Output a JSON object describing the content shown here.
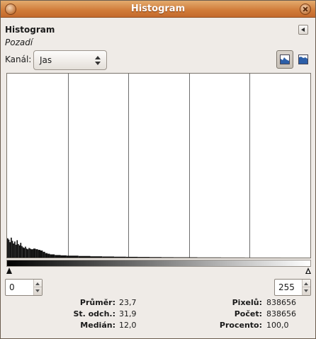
{
  "window": {
    "title": "Histogram"
  },
  "dialog": {
    "title": "Histogram",
    "subtitle": "Pozadí"
  },
  "channel": {
    "label": "Kanál:",
    "value": "Jas"
  },
  "range": {
    "min": "0",
    "max": "255"
  },
  "stats_left": [
    {
      "label": "Průměr:",
      "value": "23,7"
    },
    {
      "label": "St. odch.:",
      "value": "31,9"
    },
    {
      "label": "Medián:",
      "value": "12,0"
    }
  ],
  "stats_right": [
    {
      "label": "Pixelů:",
      "value": "838656"
    },
    {
      "label": "Počet:",
      "value": "838656"
    },
    {
      "label": "Procento:",
      "value": "100,0"
    }
  ],
  "chart_data": {
    "type": "area",
    "x_range": [
      0,
      255
    ],
    "grid": "vertical lines at quarter intervals",
    "color": "#111111",
    "bins": [
      {
        "x": 0,
        "y": 30
      },
      {
        "x": 1,
        "y": 28
      },
      {
        "x": 2,
        "y": 24
      },
      {
        "x": 3,
        "y": 31
      },
      {
        "x": 4,
        "y": 26
      },
      {
        "x": 5,
        "y": 22
      },
      {
        "x": 6,
        "y": 25
      },
      {
        "x": 7,
        "y": 20
      },
      {
        "x": 8,
        "y": 27
      },
      {
        "x": 9,
        "y": 21
      },
      {
        "x": 10,
        "y": 19
      },
      {
        "x": 11,
        "y": 23
      },
      {
        "x": 12,
        "y": 18
      },
      {
        "x": 13,
        "y": 16
      },
      {
        "x": 14,
        "y": 15
      },
      {
        "x": 15,
        "y": 17
      },
      {
        "x": 16,
        "y": 14
      },
      {
        "x": 17,
        "y": 13
      },
      {
        "x": 18,
        "y": 15
      },
      {
        "x": 19,
        "y": 14
      },
      {
        "x": 20,
        "y": 13
      },
      {
        "x": 22,
        "y": 14
      },
      {
        "x": 24,
        "y": 13
      },
      {
        "x": 26,
        "y": 12
      },
      {
        "x": 28,
        "y": 11
      },
      {
        "x": 30,
        "y": 9
      },
      {
        "x": 32,
        "y": 7
      },
      {
        "x": 34,
        "y": 6
      },
      {
        "x": 36,
        "y": 5
      },
      {
        "x": 40,
        "y": 4
      },
      {
        "x": 45,
        "y": 3.5
      },
      {
        "x": 50,
        "y": 3
      },
      {
        "x": 60,
        "y": 2.5
      },
      {
        "x": 70,
        "y": 2
      },
      {
        "x": 80,
        "y": 1.7
      },
      {
        "x": 90,
        "y": 1.4
      },
      {
        "x": 100,
        "y": 1.2
      },
      {
        "x": 110,
        "y": 1.0
      },
      {
        "x": 120,
        "y": 0.8
      },
      {
        "x": 130,
        "y": 0.6
      },
      {
        "x": 140,
        "y": 0.5
      },
      {
        "x": 160,
        "y": 0.3
      },
      {
        "x": 180,
        "y": 0.2
      },
      {
        "x": 200,
        "y": 0.1
      },
      {
        "x": 230,
        "y": 0.05
      },
      {
        "x": 255,
        "y": 0
      }
    ]
  }
}
